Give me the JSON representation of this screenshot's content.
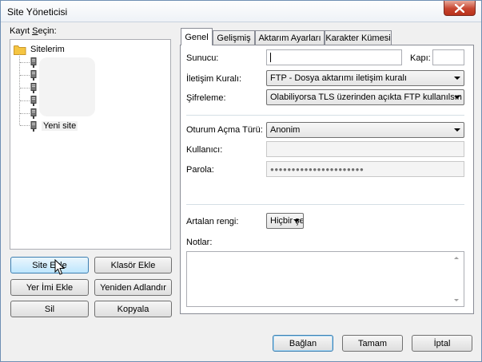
{
  "window": {
    "title": "Site Yöneticisi"
  },
  "left": {
    "select_label_pre": "Kayıt ",
    "select_label_u": "S",
    "select_label_post": "eçin:",
    "tree": {
      "root": "Sitelerim",
      "new_site": "Yeni site"
    },
    "buttons": {
      "new_site": "Site Ekle",
      "new_folder": "Klasör Ekle",
      "bookmark": "Yer İmi Ekle",
      "rename": "Yeniden Adlandır",
      "delete": "Sil",
      "copy": "Kopyala"
    }
  },
  "tabs": [
    "Genel",
    "Gelişmiş",
    "Aktarım Ayarları",
    "Karakter Kümesi"
  ],
  "general": {
    "host_label": "Sunucu:",
    "host_value": "",
    "port_label": "Kapı:",
    "port_value": "",
    "protocol_label": "İletişim Kuralı:",
    "protocol_value": "FTP - Dosya aktarımı iletişim kuralı",
    "encryption_label": "Şifreleme:",
    "encryption_value": "Olabiliyorsa TLS üzerinden açıkta FTP kullanılsın",
    "logon_label": "Oturum Açma Türü:",
    "logon_value": "Anonim",
    "user_label": "Kullanıcı:",
    "user_value": "",
    "password_label": "Parola:",
    "password_value": "●●●●●●●●●●●●●●●●●●●●●●",
    "bg_color_label": "Artalan rengi:",
    "bg_color_value": "Hiçbir şey",
    "notes_label": "Notlar:"
  },
  "footer": {
    "connect": "Bağlan",
    "ok": "Tamam",
    "cancel": "İptal"
  },
  "colors": {
    "close_button": "#c7452f",
    "folder": "#f5c542",
    "accent": "#3c7fb1"
  }
}
